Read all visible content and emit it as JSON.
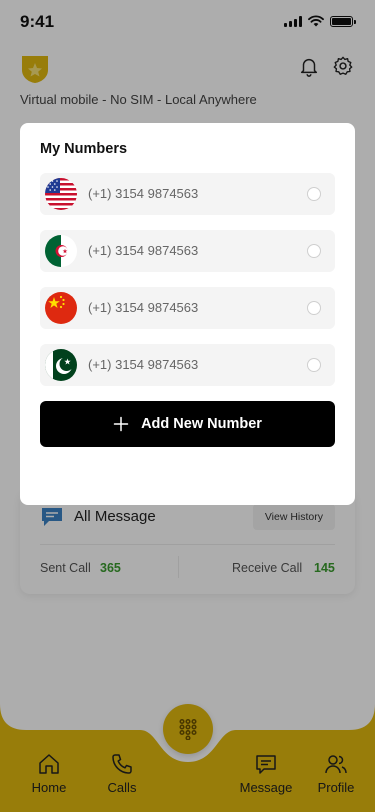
{
  "status_bar": {
    "time": "9:41"
  },
  "header": {
    "tagline": "Virtual mobile - No SIM - Local Anywhere",
    "logo_icon": "shield-star-icon",
    "notification_icon": "bell-icon",
    "settings_icon": "gear-icon"
  },
  "stats_card": {
    "title": "All Message",
    "view_history_label": "View History",
    "sent_label": "Sent Call",
    "sent_value": "365",
    "receive_label": "Receive Call",
    "receive_value": "145"
  },
  "modal": {
    "title": "My Numbers",
    "numbers": [
      {
        "country": "USA",
        "flag_icon": "us-flag-icon",
        "number": "(+1) 3154 9874563",
        "selected": false
      },
      {
        "country": "Algeria",
        "flag_icon": "algeria-flag-icon",
        "number": "(+1) 3154 9874563",
        "selected": false
      },
      {
        "country": "China",
        "flag_icon": "china-flag-icon",
        "number": "(+1) 3154 9874563",
        "selected": false
      },
      {
        "country": "Pakistan",
        "flag_icon": "pakistan-flag-icon",
        "number": "(+1) 3154 9874563",
        "selected": false
      }
    ],
    "add_button_label": "Add New Number"
  },
  "bottom_nav": {
    "items": [
      {
        "label": "Home",
        "icon": "home-icon"
      },
      {
        "label": "Calls",
        "icon": "phone-icon"
      },
      {
        "label": "Message",
        "icon": "message-icon"
      },
      {
        "label": "Profile",
        "icon": "profile-icon"
      }
    ],
    "center_icon": "dialpad-icon"
  },
  "colors": {
    "accent_yellow": "#e0b80f",
    "stat_green": "#3a9b2e",
    "button_black": "#000000"
  }
}
